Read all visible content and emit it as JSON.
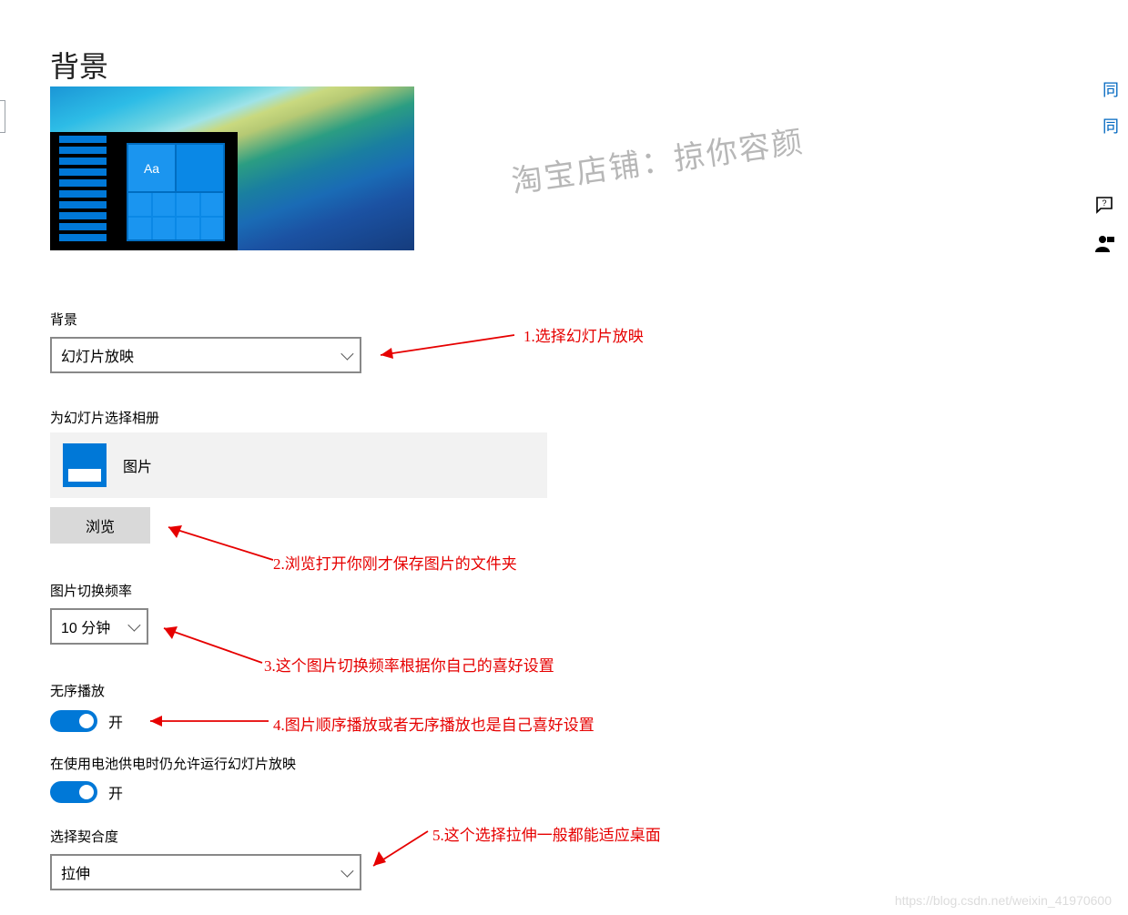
{
  "page": {
    "title": "背景"
  },
  "preview": {
    "tile_text": "Aa"
  },
  "background": {
    "label": "背景",
    "selected": "幻灯片放映"
  },
  "album": {
    "label": "为幻灯片选择相册",
    "folder_name": "图片",
    "browse_label": "浏览"
  },
  "frequency": {
    "label": "图片切换频率",
    "selected": "10 分钟"
  },
  "shuffle": {
    "label": "无序播放",
    "state_label": "开"
  },
  "battery": {
    "label": "在使用电池供电时仍允许运行幻灯片放映",
    "state_label": "开"
  },
  "fit": {
    "label": "选择契合度",
    "selected": "拉伸"
  },
  "annotations": {
    "a1": "1.选择幻灯片放映",
    "a2": "2.浏览打开你刚才保存图片的文件夹",
    "a3": "3.这个图片切换频率根据你自己的喜好设置",
    "a4": "4.图片顺序播放或者无序播放也是自己喜好设置",
    "a5": "5.这个选择拉伸一般都能适应桌面"
  },
  "right": {
    "link1": "同",
    "link2": "同"
  },
  "watermark": {
    "slanted": "淘宝店铺：掠你容颜",
    "bottom": "https://blog.csdn.net/weixin_41970600"
  }
}
